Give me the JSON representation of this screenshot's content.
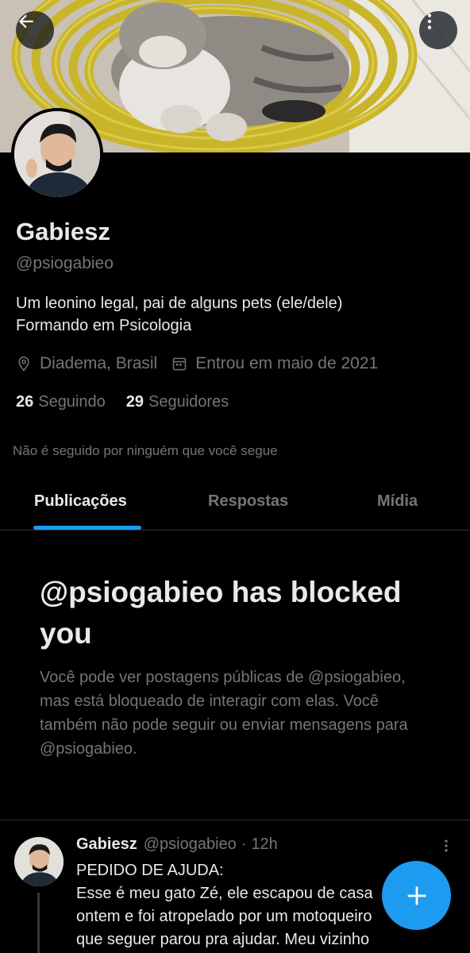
{
  "header": {
    "back_icon": "arrow-left-icon",
    "more_icon": "more-vertical-icon",
    "banner_description": "cat-on-yellow-hose-photo"
  },
  "profile": {
    "name": "Gabiesz",
    "handle": "@psiogabieo",
    "bio_line1": "Um leonino legal, pai de alguns pets (ele/dele)",
    "bio_line2": "Formando em Psicologia",
    "location": "Diadema, Brasil",
    "joined": "Entrou em maio de 2021",
    "following_count": "26",
    "following_label": "Seguindo",
    "followers_count": "29",
    "followers_label": "Seguidores",
    "not_followed_text": "Não é seguido por ninguém que você segue"
  },
  "tabs": [
    {
      "label": "Publicações",
      "active": true
    },
    {
      "label": "Respostas",
      "active": false
    },
    {
      "label": "Mídia",
      "active": false
    }
  ],
  "blocked": {
    "title": "@psiogabieo has blocked you",
    "text": "Você pode ver postagens públicas de @psiogabieo, mas está bloqueado de interagir com elas. Você também não pode seguir ou enviar mensagens para @psiogabieo."
  },
  "post": {
    "name": "Gabiesz",
    "handle": "@psiogabieo",
    "separator": "·",
    "time": "12h",
    "line1": "PEDIDO DE AJUDA:",
    "line2": "Esse é meu gato Zé, ele escapou de casa",
    "line3": "ontem e foi atropelado por um motoqueiro",
    "line4": "que seguer parou pra ajudar. Meu vizinho"
  },
  "fab": {
    "icon": "plus-icon"
  },
  "colors": {
    "accent": "#1d9bf0",
    "background": "#000000",
    "secondary_text": "#71767b",
    "primary_text": "#e7e9ea"
  }
}
